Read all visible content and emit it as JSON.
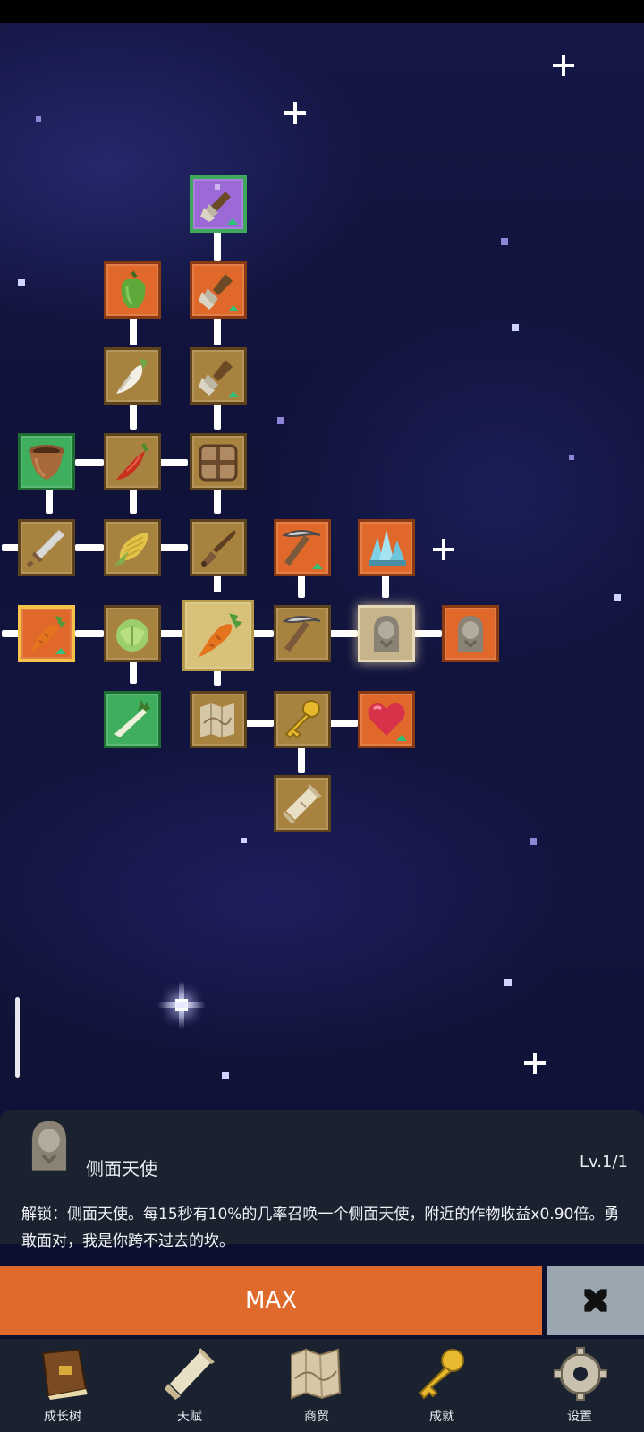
{
  "skill_panel": {
    "title": "侧面天使",
    "level": "Lv.1/1",
    "description": "解锁：侧面天使。每15秒有10%的几率召唤一个侧面天使，附近的作物收益x0.90倍。勇敢面对，我是你跨不过去的坎。"
  },
  "actions": {
    "max_label": "MAX",
    "close_icon": "close-x-icon"
  },
  "nav": {
    "tabs": [
      {
        "label": "成长树",
        "icon": "book-icon"
      },
      {
        "label": "天赋",
        "icon": "scroll-icon"
      },
      {
        "label": "商贸",
        "icon": "map-icon"
      },
      {
        "label": "成就",
        "icon": "key-icon"
      },
      {
        "label": "设置",
        "icon": "gear-icon"
      }
    ]
  },
  "skill_tree": {
    "nodes": [
      {
        "id": "golden-shovel",
        "icon": "shovel-icon",
        "style": "purple"
      },
      {
        "id": "pepper",
        "icon": "bell-pepper-icon",
        "style": "orange"
      },
      {
        "id": "shovel-2",
        "icon": "shovel-icon",
        "style": "orange"
      },
      {
        "id": "radish",
        "icon": "radish-icon",
        "style": "tan"
      },
      {
        "id": "shovel-1",
        "icon": "shovel-icon",
        "style": "tan"
      },
      {
        "id": "pot",
        "icon": "clay-pot-icon",
        "style": "green"
      },
      {
        "id": "chili",
        "icon": "chili-icon",
        "style": "tan"
      },
      {
        "id": "crate",
        "icon": "crate-icon",
        "style": "tan"
      },
      {
        "id": "sword",
        "icon": "sword-icon",
        "style": "tan"
      },
      {
        "id": "corn",
        "icon": "corn-icon",
        "style": "tan"
      },
      {
        "id": "dagger",
        "icon": "dagger-icon",
        "style": "tan"
      },
      {
        "id": "pickaxe-up",
        "icon": "pickaxe-icon",
        "style": "orange"
      },
      {
        "id": "crystal",
        "icon": "crystal-icon",
        "style": "orange"
      },
      {
        "id": "carrot-up",
        "icon": "carrot-icon",
        "style": "gold"
      },
      {
        "id": "cabbage",
        "icon": "cabbage-icon",
        "style": "tan"
      },
      {
        "id": "carrot-root",
        "icon": "carrot-icon",
        "style": "selected"
      },
      {
        "id": "pickaxe",
        "icon": "pickaxe-icon",
        "style": "tan"
      },
      {
        "id": "angel-side",
        "icon": "angel-statue-icon",
        "style": "glow"
      },
      {
        "id": "angel",
        "icon": "angel-statue-icon",
        "style": "orange"
      },
      {
        "id": "leek",
        "icon": "leek-icon",
        "style": "green"
      },
      {
        "id": "map",
        "icon": "map-icon",
        "style": "tan"
      },
      {
        "id": "key",
        "icon": "key-icon",
        "style": "tan"
      },
      {
        "id": "heart",
        "icon": "heart-icon",
        "style": "orange"
      },
      {
        "id": "scroll",
        "icon": "scroll-icon",
        "style": "tan"
      }
    ]
  },
  "colors": {
    "panel_bg": "#1a2230",
    "max_button": "#e06a2c",
    "close_button": "#9aa6b0",
    "node_tan": "#a8833f",
    "node_orange": "#e0682a",
    "node_green": "#3fae5d"
  }
}
